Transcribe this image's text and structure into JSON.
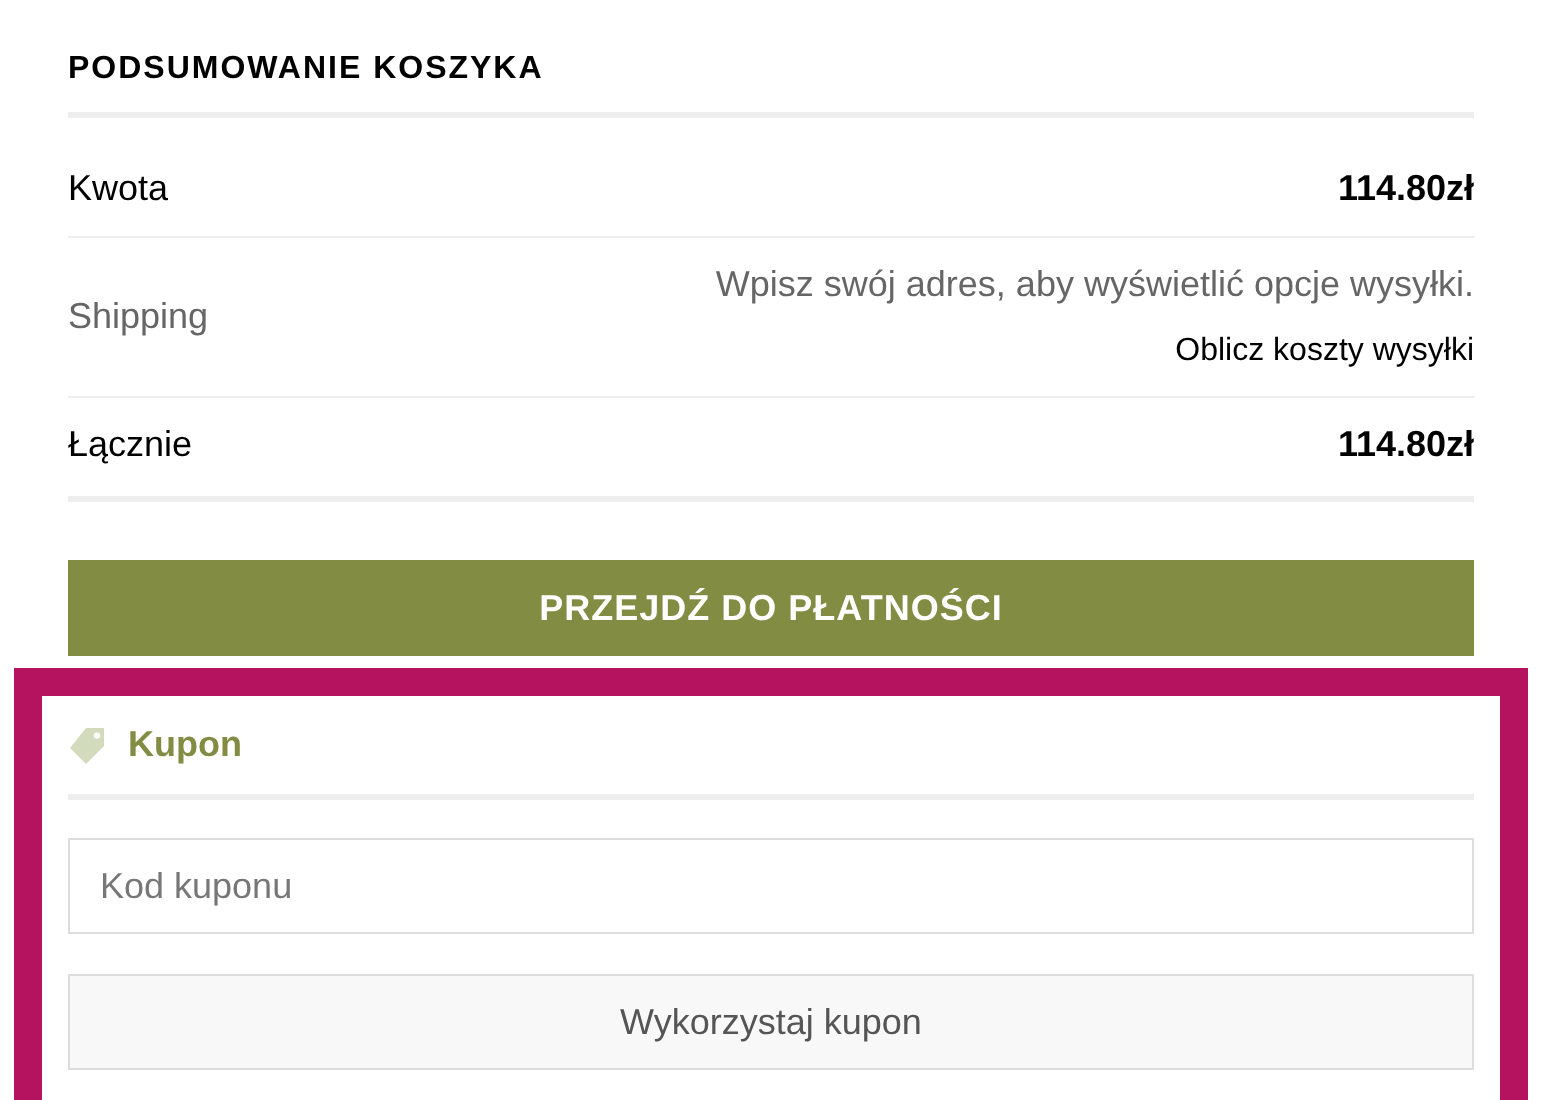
{
  "title": "PODSUMOWANIE KOSZYKA",
  "rows": [
    {
      "kind": "amount",
      "label": "Kwota",
      "value": "114.80zł"
    },
    {
      "kind": "shipping",
      "label": "Shipping",
      "note": "Wpisz swój adres, aby wyświetlić opcje wysyłki.",
      "link": "Oblicz koszty wysyłki"
    },
    {
      "kind": "amount",
      "label": "Łącznie",
      "value": "114.80zł"
    }
  ],
  "checkout_button": "PRZEJDŹ DO PŁATNOŚCI",
  "coupon": {
    "title": "Kupon",
    "placeholder": "Kod kuponu",
    "button": "Wykorzystaj kupon"
  }
}
